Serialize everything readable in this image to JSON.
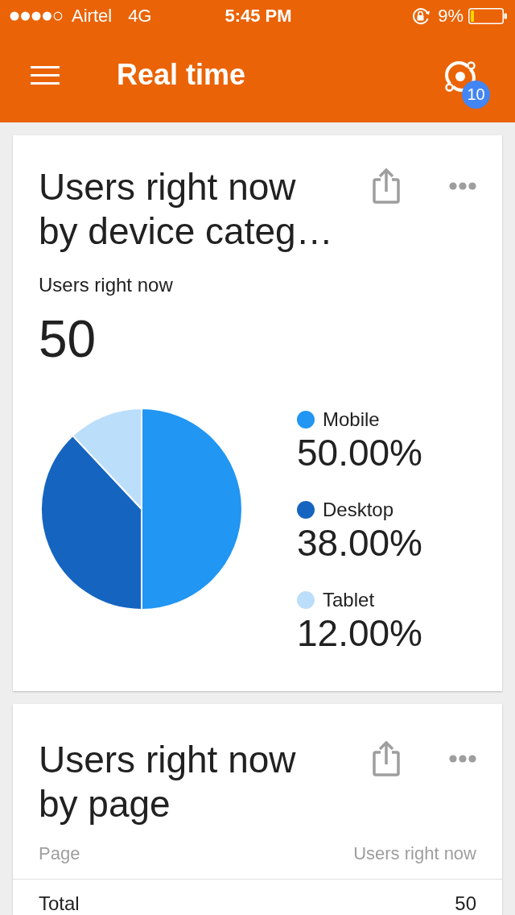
{
  "status_bar": {
    "carrier": "Airtel",
    "network": "4G",
    "time": "5:45 PM",
    "battery": "9%"
  },
  "app_bar": {
    "title": "Real time",
    "badge": "10"
  },
  "cards": [
    {
      "kind": "pie",
      "title": "Users right now by device categ…",
      "metric_label": "Users right now",
      "metric_value": "50",
      "chart_data": {
        "type": "pie",
        "categories": [
          "Mobile",
          "Desktop",
          "Tablet"
        ],
        "values": [
          50,
          38,
          12
        ]
      },
      "legend": [
        {
          "value": "50.00%",
          "color": "#2196f3"
        },
        {
          "value": "38.00%",
          "color": "#1565c0"
        },
        {
          "value": "12.00%",
          "color": "#bbdefb"
        }
      ]
    },
    {
      "kind": "table",
      "title": "Users right now by page",
      "table": {
        "columns": [
          "Page",
          "Users right now"
        ],
        "rows": [
          [
            "Total",
            "50"
          ]
        ]
      }
    }
  ]
}
